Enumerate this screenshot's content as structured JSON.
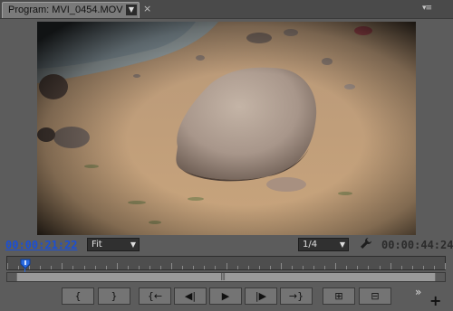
{
  "panel": {
    "tab_title": "Program: MVI_0454.MOV",
    "tab_dropdown_icon": "chevron-down-icon",
    "tab_close_glyph": "×",
    "menu_glyph": "▾≡"
  },
  "video": {
    "description_icon": "beach-rock-frame"
  },
  "timecode": {
    "current": "00:00:21:22",
    "duration": "00:00:44:24",
    "current_color": "#1a4fd6"
  },
  "zoom": {
    "selected": "Fit"
  },
  "resolution": {
    "selected": "1/4"
  },
  "settings": {
    "icon": "wrench-icon"
  },
  "timeline": {
    "playhead_position": 0.02
  },
  "transport": {
    "buttons": [
      {
        "name": "mark-in",
        "glyph": "{"
      },
      {
        "name": "mark-out",
        "glyph": "}"
      },
      {
        "name": "go-to-in",
        "glyph": "{←"
      },
      {
        "name": "step-back",
        "glyph": "◀|"
      },
      {
        "name": "play",
        "glyph": "▶"
      },
      {
        "name": "step-forward",
        "glyph": "|▶"
      },
      {
        "name": "go-to-out",
        "glyph": "→}"
      },
      {
        "name": "lift",
        "glyph": "⊞"
      },
      {
        "name": "extract",
        "glyph": "⊟"
      }
    ],
    "more_glyph": "»",
    "add_glyph": "+"
  }
}
